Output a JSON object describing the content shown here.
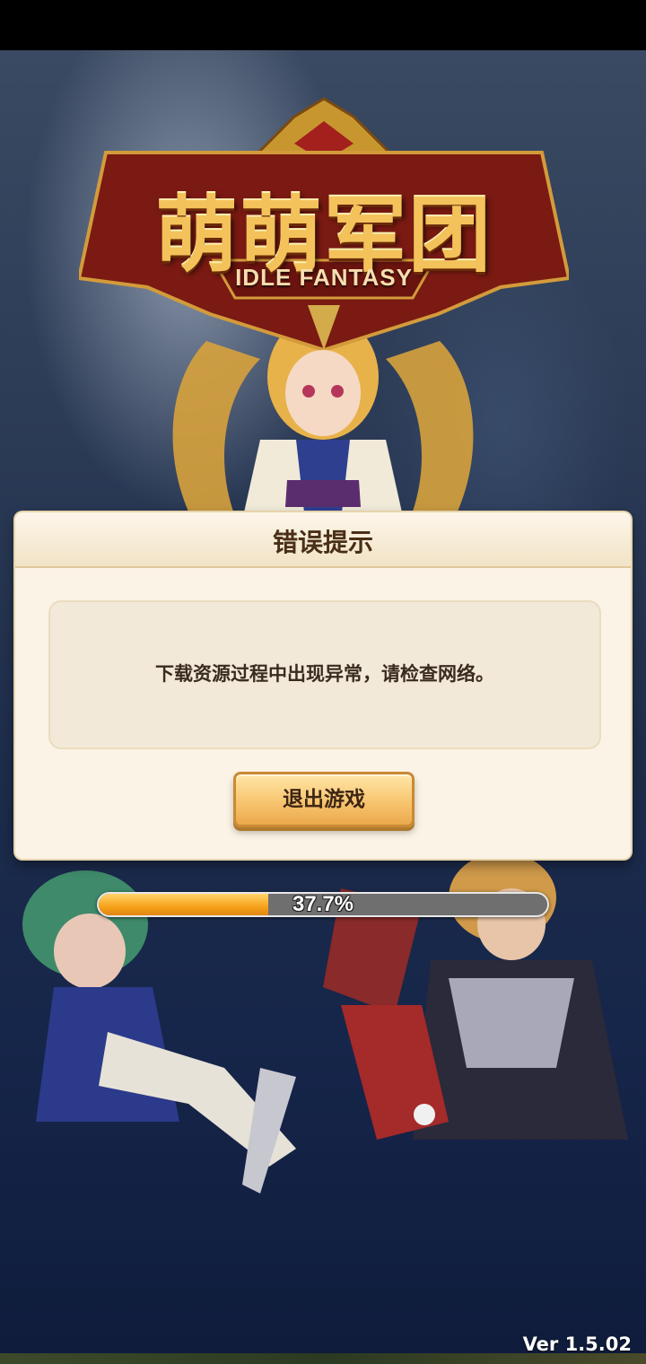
{
  "logo": {
    "title": "萌萌军团",
    "subtitle": "IDLE FANTASY"
  },
  "dialog": {
    "title": "错误提示",
    "message": "下载资源过程中出现异常，请检查网络。",
    "exit_button_label": "退出游戏"
  },
  "loading": {
    "progress_fraction": 0.377,
    "progress_label": "37.7%"
  },
  "version": "Ver 1.5.02",
  "colors": {
    "dialog_background": "#fbf3e5",
    "button_gold": "#f7c56f",
    "progress_fill": "#f7a21b",
    "progress_track": "#6f6f6f"
  }
}
